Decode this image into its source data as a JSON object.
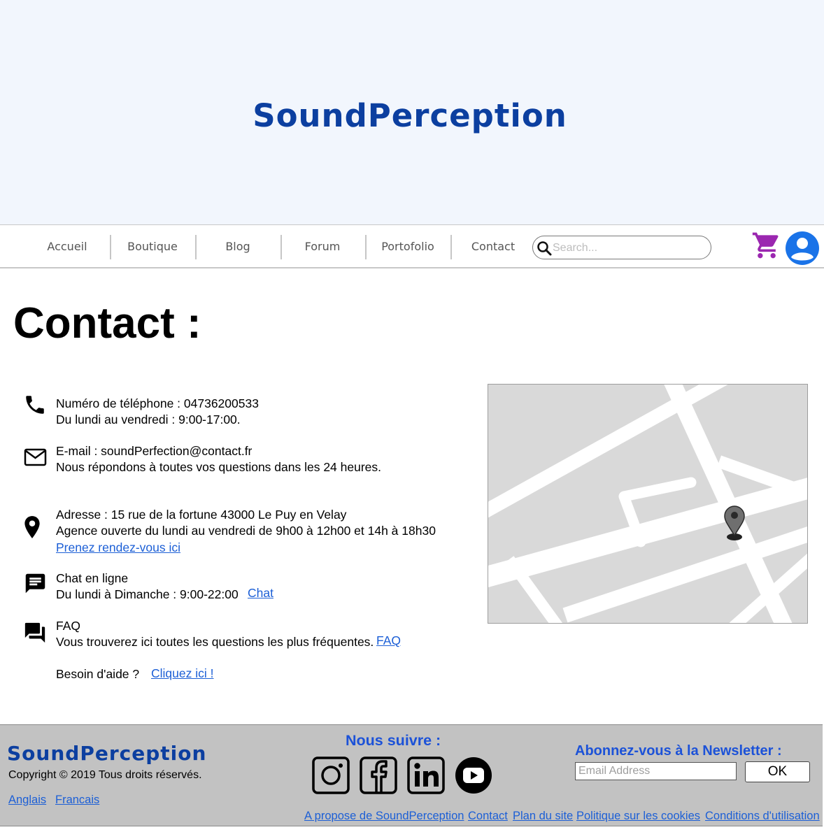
{
  "header": {
    "site_title": "SoundPerception"
  },
  "nav": {
    "items": [
      {
        "label": "Accueil"
      },
      {
        "label": "Boutique"
      },
      {
        "label": "Blog"
      },
      {
        "label": "Forum"
      },
      {
        "label": "Portofolio"
      },
      {
        "label": "Contact"
      }
    ],
    "search_placeholder": "Search...",
    "icons": [
      "search-icon",
      "cart-icon",
      "account-icon"
    ],
    "cart_color": "#9b27b0",
    "account_color": "#1a73e8"
  },
  "main": {
    "title": "Contact :",
    "phone": {
      "line1": "Numéro de téléphone : 04736200533",
      "line2": "Du lundi au vendredi : 9:00-17:00."
    },
    "email": {
      "line1": "E-mail : soundPerfection@contact.fr",
      "line2": "Nous répondons à toutes vos questions dans les 24 heures."
    },
    "address": {
      "line1": "Adresse : 15 rue de la fortune 43000 Le Puy en Velay",
      "line2": "Agence ouverte du lundi au vendredi de 9h00 à 12h00 et 14h à 18h30",
      "link": "Prenez rendez-vous ici"
    },
    "chat": {
      "line1": "Chat en ligne",
      "line2": "Du lundi à Dimanche : 9:00-22:00",
      "link": "Chat"
    },
    "faq": {
      "line1": "FAQ",
      "line2": "Vous trouverez ici toutes les questions les plus fréquentes.",
      "link": "FAQ"
    },
    "help": {
      "text": "Besoin d'aide ?",
      "link": "Cliquez ici !"
    }
  },
  "footer": {
    "brand": "SoundPerception",
    "copyright": "Copyright © 2019 Tous droits réservés.",
    "languages": [
      "Anglais",
      "Francais"
    ],
    "follow_title": "Nous suivre :",
    "socials": [
      "instagram-icon",
      "facebook-icon",
      "linkedin-icon",
      "youtube-icon"
    ],
    "newsletter_title": "Abonnez-vous à la Newsletter :",
    "newsletter_placeholder": "Email Address",
    "ok_label": "OK",
    "links": [
      "A propose de SoundPerception",
      "Contact",
      "Plan du site",
      "Politique sur les cookies",
      "Conditions d'utilisation"
    ]
  }
}
